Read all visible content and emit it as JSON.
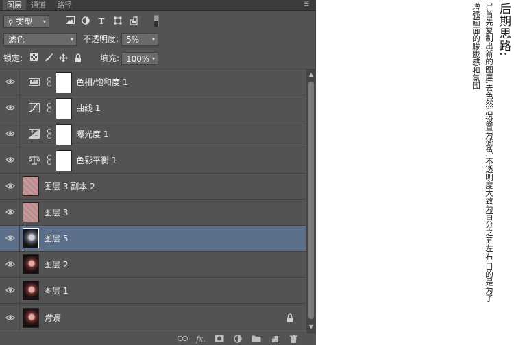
{
  "tabs": [
    {
      "label": "图层"
    },
    {
      "label": "通道"
    },
    {
      "label": "路径"
    }
  ],
  "filter": {
    "kind_label": "类型"
  },
  "blend": {
    "mode": "滤色",
    "opacity_label": "不透明度:",
    "opacity_value": "5%"
  },
  "lock": {
    "label": "锁定:",
    "fill_label": "填充:",
    "fill_value": "100%"
  },
  "layers": [
    {
      "name": "色相/饱和度 1",
      "kind": "adjustment",
      "icon": "hue-saturation-icon"
    },
    {
      "name": "曲线 1",
      "kind": "adjustment",
      "icon": "curves-icon"
    },
    {
      "name": "曝光度 1",
      "kind": "adjustment",
      "icon": "exposure-icon"
    },
    {
      "name": "色彩平衡 1",
      "kind": "adjustment",
      "icon": "color-balance-icon"
    },
    {
      "name": "图层 3 副本 2",
      "kind": "pixel",
      "thumb": "pink"
    },
    {
      "name": "图层 3",
      "kind": "pixel",
      "thumb": "pink"
    },
    {
      "name": "图层 5",
      "kind": "pixel",
      "thumb": "photo",
      "selected": true
    },
    {
      "name": "图层 2",
      "kind": "pixel",
      "thumb": "photo"
    },
    {
      "name": "图层 1",
      "kind": "pixel",
      "thumb": "photo"
    },
    {
      "name": "背景",
      "kind": "background",
      "thumb": "photo",
      "locked": true
    }
  ],
  "footer": {
    "fx_label": "fx."
  },
  "notes": {
    "title": "后期思路:",
    "line1": "1.首先复制出新的图层,去色然后设置为滤色,不透明度大致为百分之五左右,目的是为了",
    "line2": "增强画面的朦胧感和氛围"
  },
  "colors": {
    "panel_bg": "#535353",
    "selected_row": "#5b6e8a",
    "tab_bar": "#3c3c3c"
  }
}
